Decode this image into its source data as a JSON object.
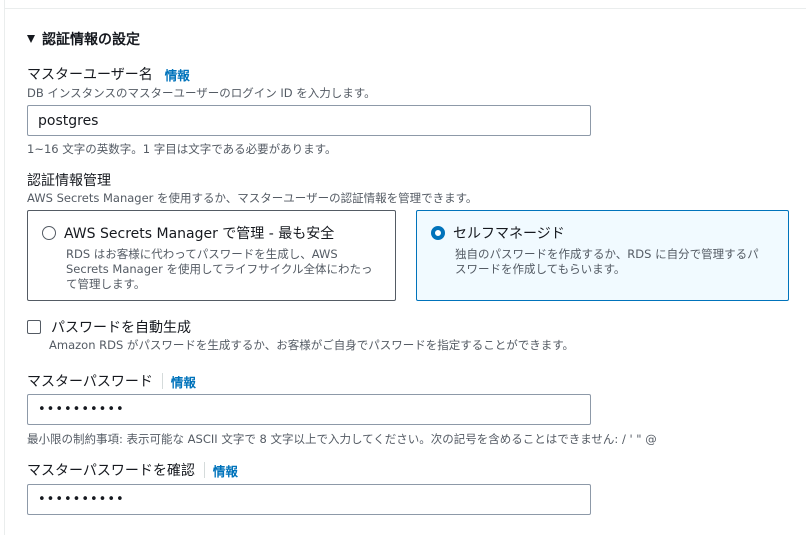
{
  "section": {
    "title": "認証情報の設定"
  },
  "master_user": {
    "label": "マスターユーザー名",
    "info": "情報",
    "description": "DB インスタンスのマスターユーザーのログイン ID を入力します。",
    "value": "postgres",
    "constraint": "1~16 文字の英数字。1 字目は文字である必要があります。"
  },
  "credential_management": {
    "label": "認証情報管理",
    "description": "AWS Secrets Manager を使用するか、マスターユーザーの認証情報を管理できます。",
    "options": [
      {
        "title": "AWS Secrets Manager で管理 - 最も安全",
        "desc_lines": [
          "RDS はお客様に代わってパスワードを生成し、AWS",
          "Secrets Manager を使用してライフサイクル全体にわたっ",
          "て管理します。"
        ],
        "selected": false
      },
      {
        "title": "セルフマネージド",
        "desc_lines": [
          "独自のパスワードを作成するか、RDS に自分で管理するパ",
          "スワードを作成してもらいます。"
        ],
        "selected": true
      }
    ]
  },
  "auto_generate": {
    "label": "パスワードを自動生成",
    "description": "Amazon RDS がパスワードを生成するか、お客様がご自身でパスワードを指定することができます。",
    "checked": false
  },
  "master_password": {
    "label": "マスターパスワード",
    "info": "情報",
    "value": "••••••••••",
    "constraint": "最小限の制約事項: 表示可能な ASCII 文字で 8 文字以上で入力してください。次の記号を含めることはできません: / ' \" @"
  },
  "confirm_password": {
    "label": "マスターパスワードを確認",
    "info": "情報",
    "value": "••••••••••"
  },
  "colors": {
    "accent": "#0073bb",
    "selected_bg": "#f1faff",
    "text": "#16191f",
    "muted": "#545b64"
  }
}
